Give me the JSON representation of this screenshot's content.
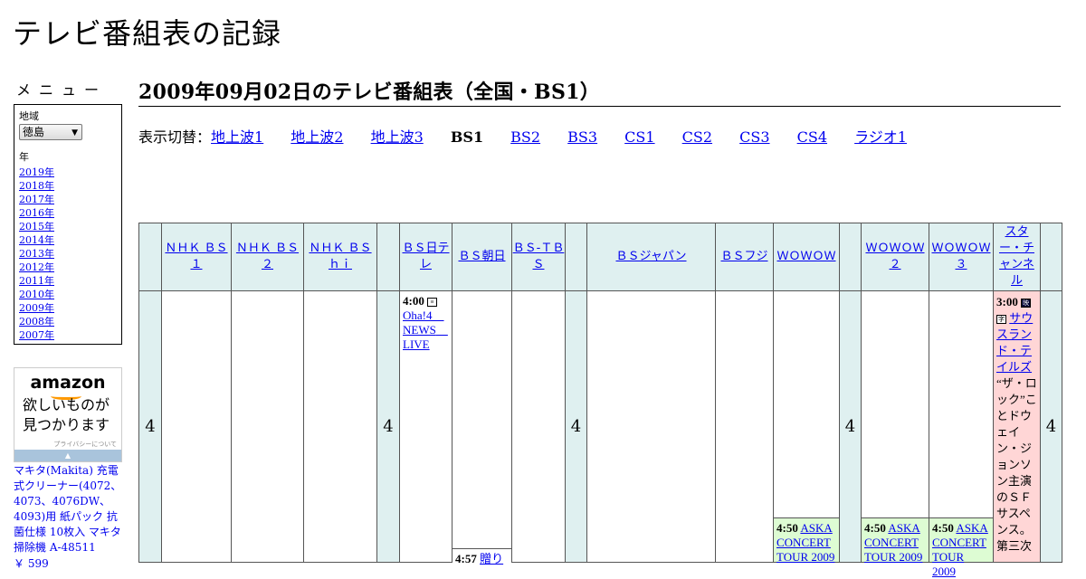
{
  "site": {
    "title": "テレビ番組表の記録"
  },
  "sidebar": {
    "menu_heading": "メニュー",
    "region_label": "地域",
    "region_value": "徳島",
    "year_label": "年",
    "years": [
      "2019年",
      "2018年",
      "2017年",
      "2016年",
      "2015年",
      "2014年",
      "2013年",
      "2012年",
      "2011年",
      "2010年",
      "2009年",
      "2008年",
      "2007年"
    ]
  },
  "ad": {
    "logo": "amazon",
    "catch_line1": "欲しいものが",
    "catch_line2": "見つかります",
    "privacy": "プライバシーについて",
    "product": "マキタ(Makita) 充電式クリーナー(4072、4073、4076DW、4093)用 紙パック 抗菌仕様 10枚入 マキタ 掃除機 A-48511",
    "price": "￥ 599"
  },
  "main": {
    "page_title": "2009年09月02日のテレビ番組表（全国・BS1）",
    "switch_label": "表示切替：",
    "switch_items": [
      {
        "label": "地上波1",
        "current": false
      },
      {
        "label": "地上波2",
        "current": false
      },
      {
        "label": "地上波3",
        "current": false
      },
      {
        "label": "BS1",
        "current": true
      },
      {
        "label": "BS2",
        "current": false
      },
      {
        "label": "BS3",
        "current": false
      },
      {
        "label": "CS1",
        "current": false
      },
      {
        "label": "CS2",
        "current": false
      },
      {
        "label": "CS3",
        "current": false
      },
      {
        "label": "CS4",
        "current": false
      },
      {
        "label": "ラジオ1",
        "current": false
      }
    ]
  },
  "grid": {
    "hour": "4",
    "channels": {
      "nhk_bs1": "ＮＨＫ ＢＳ １",
      "nhk_bs2": "ＮＨＫ ＢＳ ２",
      "nhk_bshi": "ＮＨＫ ＢＳ ｈｉ",
      "bs_ntv": "ＢＳ日テレ",
      "bs_asahi": "ＢＳ朝日",
      "bs_tbs": "ＢＳ-ＴＢＳ",
      "bs_japan": "ＢＳジャパン",
      "bs_fuji": "ＢＳフジ",
      "wowow": "ＷＯＷＯＷ",
      "wowow2": "ＷＯＷＯＷ ２",
      "wowow3": "ＷＯＷＯＷ ３",
      "star": "スター・チャンネル"
    },
    "programs": {
      "ntv_time": "4:00",
      "ntv_title": "Oha!4　NEWS　LIVE",
      "asahi_time": "4:57",
      "asahi_title": "贈り",
      "wowow_time": "4:50",
      "wowow_title": "ASKA CONCERT TOUR 2009",
      "wowow2_time": "4:50",
      "wowow2_title": "ASKA CONCERT TOUR 2009",
      "wowow3_time": "4:50",
      "wowow3_title": "ASKA CONCERT TOUR 2009",
      "star_time": "3:00",
      "star_title": "サウスランド・テイルズ",
      "star_desc": "“ザ・ロック”ことドウェイン・ジョンソン主演のＳＦサスペンス。第三次"
    },
    "colors": {
      "header_bg": "#dff0f0",
      "green": "#ddfcd3",
      "pink": "#ffd6d6"
    }
  }
}
